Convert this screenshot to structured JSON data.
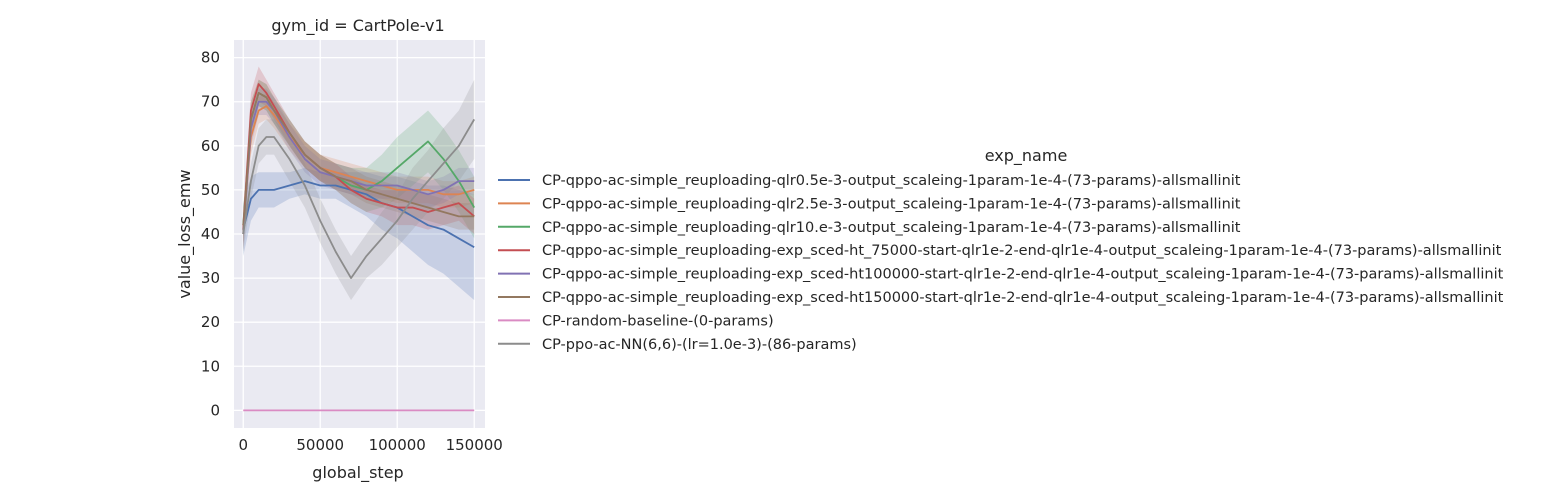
{
  "chart_data": {
    "type": "line",
    "title": "gym_id = CartPole-v1",
    "xlabel": "global_step",
    "ylabel": "value_loss_emw",
    "xlim": [
      -6000,
      157000
    ],
    "ylim": [
      -4,
      84
    ],
    "x_ticks": [
      0,
      50000,
      100000,
      150000
    ],
    "x_tick_labels": [
      "0",
      "50000",
      "100000",
      "150000"
    ],
    "y_ticks": [
      0,
      10,
      20,
      30,
      40,
      50,
      60,
      70,
      80
    ],
    "y_tick_labels": [
      "0",
      "10",
      "20",
      "30",
      "40",
      "50",
      "60",
      "70",
      "80"
    ],
    "grid": true,
    "legend_title": "exp_name",
    "legend_position": "right, outside",
    "x": [
      0,
      5000,
      10000,
      15000,
      20000,
      30000,
      40000,
      50000,
      60000,
      70000,
      80000,
      90000,
      100000,
      110000,
      120000,
      130000,
      140000,
      150000
    ],
    "series": [
      {
        "name": "CP-qppo-ac-simple_reuploading-qlr0.5e-3-output_scaleing-1param-1e-4-(73-params)-allsmallinit",
        "color": "#4c72b0",
        "values": [
          41,
          48,
          50,
          50,
          50,
          51,
          52,
          51,
          51,
          50,
          49,
          47,
          46,
          44,
          42,
          41,
          39,
          37
        ],
        "ci": [
          6,
          5,
          4,
          4,
          4,
          3,
          3,
          3,
          3,
          4,
          5,
          6,
          7,
          8,
          9,
          10,
          11,
          12
        ]
      },
      {
        "name": "CP-qppo-ac-simple_reuploading-qlr2.5e-3-output_scaleing-1param-1e-4-(73-params)-allsmallinit",
        "color": "#dd8452",
        "values": [
          42,
          62,
          68,
          69,
          67,
          62,
          58,
          55,
          54,
          53,
          52,
          51,
          50,
          50,
          50,
          49,
          49,
          50
        ],
        "ci": [
          4,
          4,
          3,
          3,
          3,
          3,
          3,
          3,
          3,
          3,
          3,
          3,
          3,
          3,
          3,
          3,
          3,
          3
        ]
      },
      {
        "name": "CP-qppo-ac-simple_reuploading-qlr10.e-3-output_scaleing-1param-1e-4-(73-params)-allsmallinit",
        "color": "#55a868",
        "values": [
          42,
          66,
          72,
          71,
          68,
          63,
          58,
          55,
          53,
          51,
          50,
          52,
          55,
          58,
          61,
          57,
          52,
          46
        ],
        "ci": [
          4,
          4,
          3,
          3,
          3,
          3,
          3,
          3,
          3,
          4,
          5,
          6,
          7,
          7,
          7,
          7,
          7,
          7
        ]
      },
      {
        "name": "CP-qppo-ac-simple_reuploading-exp_sced-ht_75000-start-qlr1e-2-end-qlr1e-4-output_scaleing-1param-1e-4-(73-params)-allsmallinit",
        "color": "#c44e52",
        "values": [
          41,
          68,
          74,
          72,
          69,
          63,
          58,
          55,
          53,
          50,
          48,
          47,
          46,
          46,
          45,
          46,
          47,
          44
        ],
        "ci": [
          4,
          4,
          4,
          3,
          3,
          3,
          3,
          3,
          3,
          3,
          3,
          3,
          4,
          4,
          4,
          4,
          4,
          4
        ]
      },
      {
        "name": "CP-qppo-ac-simple_reuploading-exp_sced-ht100000-start-qlr1e-2-end-qlr1e-4-output_scaleing-1param-1e-4-(73-params)-allsmallinit",
        "color": "#8172b3",
        "values": [
          40,
          64,
          70,
          70,
          68,
          62,
          57,
          54,
          53,
          52,
          51,
          51,
          51,
          50,
          49,
          50,
          52,
          52
        ],
        "ci": [
          4,
          4,
          3,
          3,
          3,
          3,
          3,
          3,
          3,
          3,
          3,
          3,
          3,
          3,
          3,
          3,
          3,
          3
        ]
      },
      {
        "name": "CP-qppo-ac-simple_reuploading-exp_sced-ht150000-start-qlr1e-2-end-qlr1e-4-output_scaleing-1param-1e-4-(73-params)-allsmallinit",
        "color": "#937860",
        "values": [
          40,
          66,
          72,
          71,
          68,
          63,
          58,
          55,
          53,
          52,
          50,
          49,
          48,
          47,
          46,
          45,
          44,
          44
        ],
        "ci": [
          4,
          4,
          3,
          3,
          3,
          3,
          3,
          3,
          3,
          3,
          3,
          3,
          3,
          3,
          3,
          3,
          3,
          3
        ]
      },
      {
        "name": "CP-random-baseline-(0-params)",
        "color": "#da8bc3",
        "values": [
          0,
          0,
          0,
          0,
          0,
          0,
          0,
          0,
          0,
          0,
          0,
          0,
          0,
          0,
          0,
          0,
          0,
          0
        ],
        "ci": [
          0,
          0,
          0,
          0,
          0,
          0,
          0,
          0,
          0,
          0,
          0,
          0,
          0,
          0,
          0,
          0,
          0,
          0
        ]
      },
      {
        "name": "CP-ppo-ac-NN(6,6)-(lr=1.0e-3)-(86-params)",
        "color": "#8c8c8c",
        "values": [
          40,
          52,
          60,
          62,
          62,
          57,
          51,
          43,
          36,
          30,
          35,
          39,
          43,
          48,
          52,
          56,
          60,
          66
        ],
        "ci": [
          4,
          4,
          4,
          4,
          4,
          5,
          5,
          5,
          5,
          5,
          5,
          6,
          6,
          7,
          7,
          8,
          8,
          9
        ]
      }
    ]
  }
}
